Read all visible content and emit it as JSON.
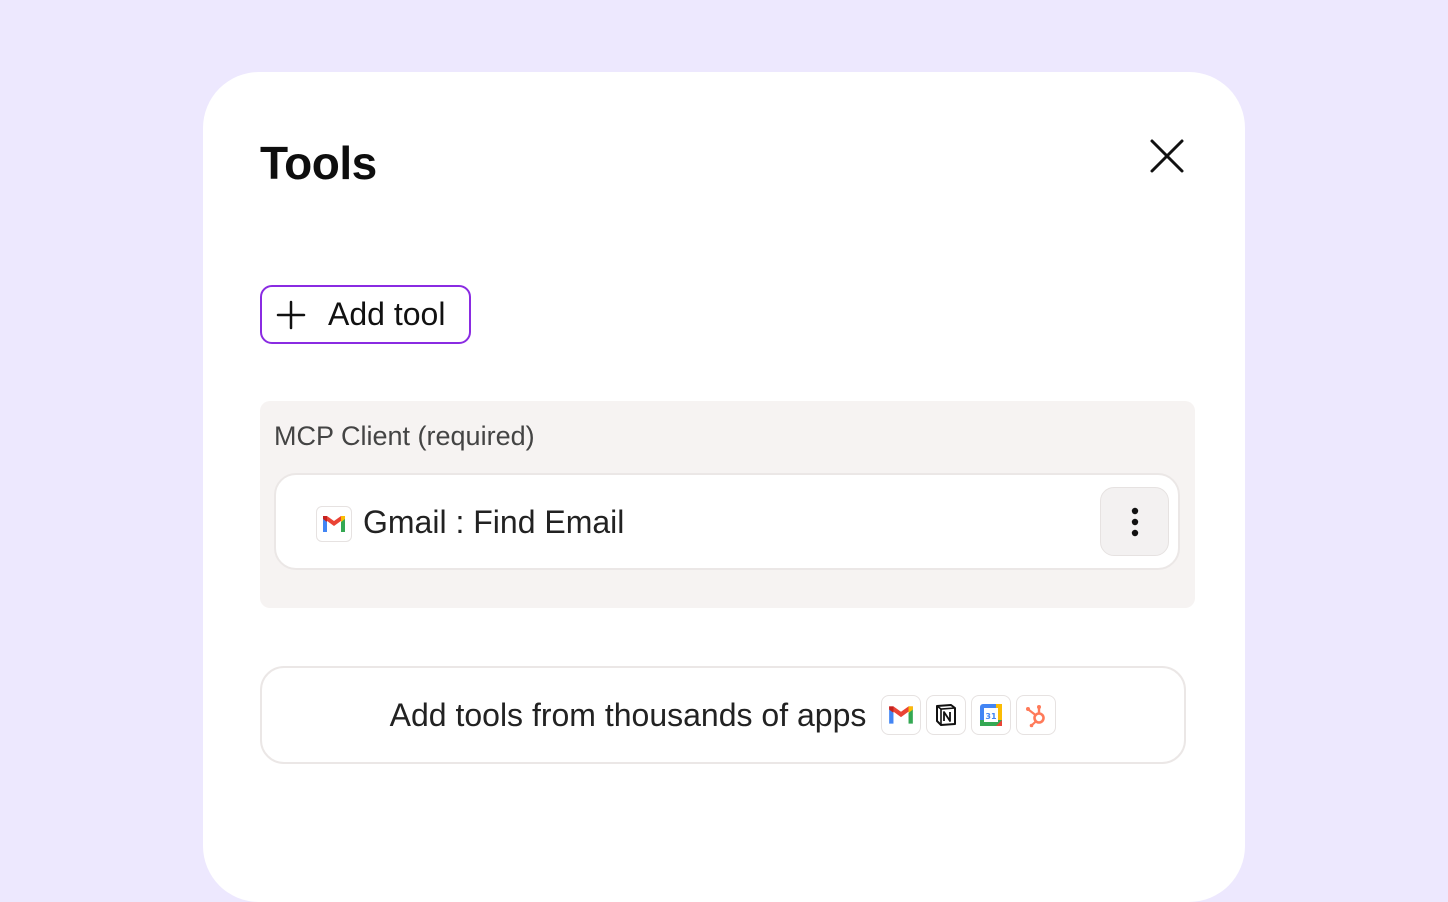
{
  "panel": {
    "title": "Tools",
    "add_tool_label": "Add tool"
  },
  "mcp_section": {
    "heading": "MCP Client (required)",
    "tools": [
      {
        "name": "Gmail : Find Email",
        "icon": "gmail-icon"
      }
    ]
  },
  "apps_button": {
    "label": "Add tools from thousands of apps",
    "logos": [
      "gmail-icon",
      "notion-icon",
      "google-calendar-icon",
      "hubspot-icon"
    ],
    "calendar_date": "31"
  },
  "colors": {
    "background": "#ede8fe",
    "accent_border": "#8a2be2",
    "section_bg": "#f6f3f2"
  }
}
